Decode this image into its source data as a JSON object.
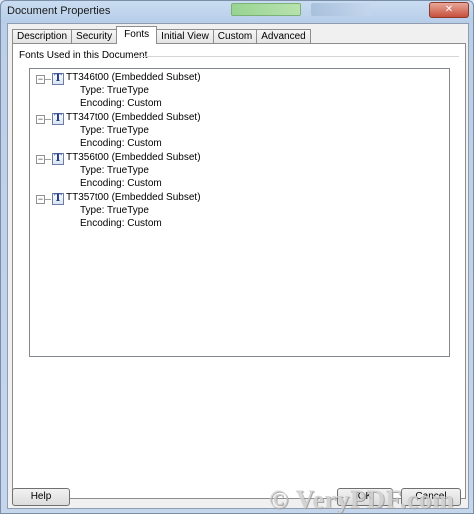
{
  "window": {
    "title": "Document Properties"
  },
  "tabs": [
    {
      "label": "Description"
    },
    {
      "label": "Security"
    },
    {
      "label": "Fonts",
      "active": true
    },
    {
      "label": "Initial View"
    },
    {
      "label": "Custom"
    },
    {
      "label": "Advanced"
    }
  ],
  "fonts_panel": {
    "group_label": "Fonts Used in this Document",
    "fonts": [
      {
        "name": "TT346t00 (Embedded Subset)",
        "type": "Type: TrueType",
        "encoding": "Encoding: Custom"
      },
      {
        "name": "TT347t00 (Embedded Subset)",
        "type": "Type: TrueType",
        "encoding": "Encoding: Custom"
      },
      {
        "name": "TT356t00 (Embedded Subset)",
        "type": "Type: TrueType",
        "encoding": "Encoding: Custom"
      },
      {
        "name": "TT357t00 (Embedded Subset)",
        "type": "Type: TrueType",
        "encoding": "Encoding: Custom"
      }
    ],
    "expander_symbol": "−",
    "font_icon_glyph": "T"
  },
  "footer": {
    "help_label": "Help",
    "ok_label": "OK",
    "cancel_label": "Cancel"
  },
  "watermark": "© VeryPDF.com",
  "colors": {
    "title_bar": "#c9dcf1",
    "panel_bg": "#ffffff",
    "dialog_bg": "#f0f0f0"
  },
  "icons": {
    "expander": "minus-box-icon",
    "font": "truetype-font-icon",
    "close": "close-icon"
  }
}
